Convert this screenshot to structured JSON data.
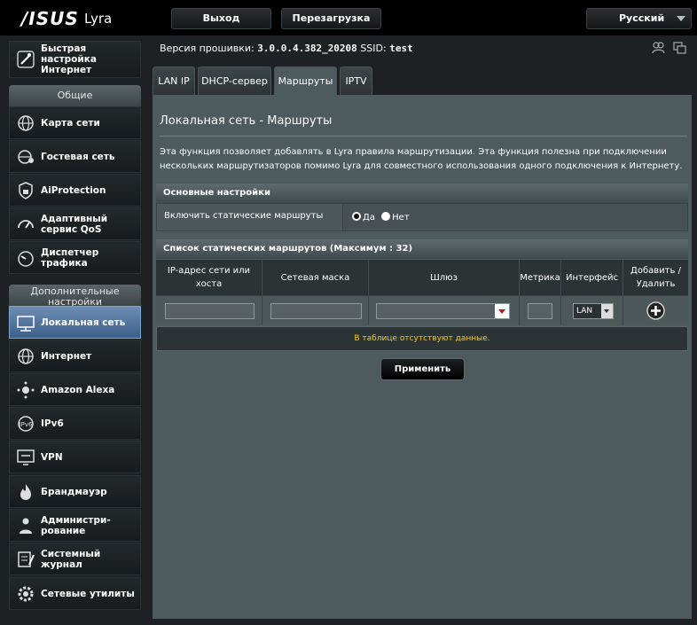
{
  "header": {
    "logo": "/ISUS",
    "product": "Lyra",
    "logout_label": "Выход",
    "reboot_label": "Перезагрузка",
    "language": "Русский"
  },
  "sidebar": {
    "quick_setup": "Быстрая настройка Интернет",
    "general_header": "Общие",
    "general_items": [
      {
        "label": "Карта сети"
      },
      {
        "label": "Гостевая сеть"
      },
      {
        "label": "AiProtection"
      },
      {
        "label": "Адаптивный сервис QoS"
      },
      {
        "label": "Диспетчер трафика"
      }
    ],
    "advanced_header": "Дополнительные настройки",
    "advanced_items": [
      {
        "label": "Локальная сеть"
      },
      {
        "label": "Интернет"
      },
      {
        "label": "Amazon Alexa"
      },
      {
        "label": "IPv6"
      },
      {
        "label": "VPN"
      },
      {
        "label": "Брандмауэр"
      },
      {
        "label": "Администри- рование"
      },
      {
        "label": "Системный журнал"
      },
      {
        "label": "Сетевые утилиты"
      }
    ]
  },
  "firmware": {
    "label": "Версия прошивки:",
    "version": "3.0.0.4.382_20208",
    "ssid_label": "SSID:",
    "ssid": "test"
  },
  "tabs": [
    "LAN IP",
    "DHCP-сервер",
    "Маршруты",
    "IPTV"
  ],
  "panel": {
    "title": "Локальная сеть - Маршруты",
    "description": "Эта функция позволяет добавлять в Lyra правила маршрутизации. Эта функция полезна при подключении нескольких маршрутизаторов помимо Lyra для совместного использования одного подключения к Интернету.",
    "basic_header": "Основные настройки",
    "static_label": "Включить статические маршруты",
    "yes_label": "Да",
    "no_label": "Нет",
    "list_header": "Список статических маршрутов (Максимум : 32)",
    "columns": [
      "IP-адрес сети или хоста",
      "Сетевая маска",
      "Шлюз",
      "Метрика",
      "Интерфейс",
      "Добавить / Удалить"
    ],
    "interface_value": "LAN",
    "empty_text": "В таблице отсутствуют данные.",
    "apply_label": "Применить"
  }
}
